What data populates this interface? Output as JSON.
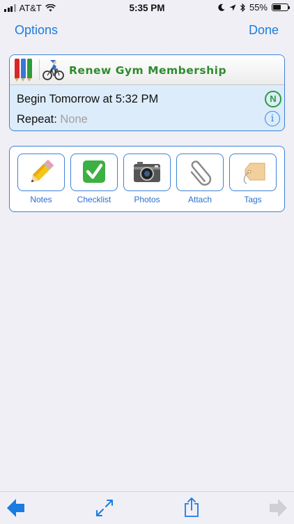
{
  "status_bar": {
    "carrier": "AT&T",
    "time": "5:35 PM",
    "battery_text": "55%",
    "battery_level": 0.55
  },
  "nav": {
    "left_label": "Options",
    "right_label": "Done"
  },
  "task": {
    "title": "Renew Gym Membership",
    "begin_text": "Begin Tomorrow at 5:32 PM",
    "repeat_label": "Repeat:",
    "repeat_value": "None",
    "badge_letter": "N",
    "info_glyph": "i"
  },
  "actions": [
    {
      "label": "Notes",
      "icon": "pencil-icon"
    },
    {
      "label": "Checklist",
      "icon": "check-icon"
    },
    {
      "label": "Photos",
      "icon": "camera-icon"
    },
    {
      "label": "Attach",
      "icon": "paperclip-icon"
    },
    {
      "label": "Tags",
      "icon": "tag-icon"
    }
  ],
  "toolbar": {
    "icons": [
      "back-arrow-icon",
      "expand-icon",
      "share-icon",
      "forward-arrow-icon"
    ]
  },
  "colors": {
    "accent": "#1a7ce0",
    "title_green": "#2e8b2e",
    "card_bg": "#dcecfa",
    "page_bg": "#f0eff5"
  }
}
